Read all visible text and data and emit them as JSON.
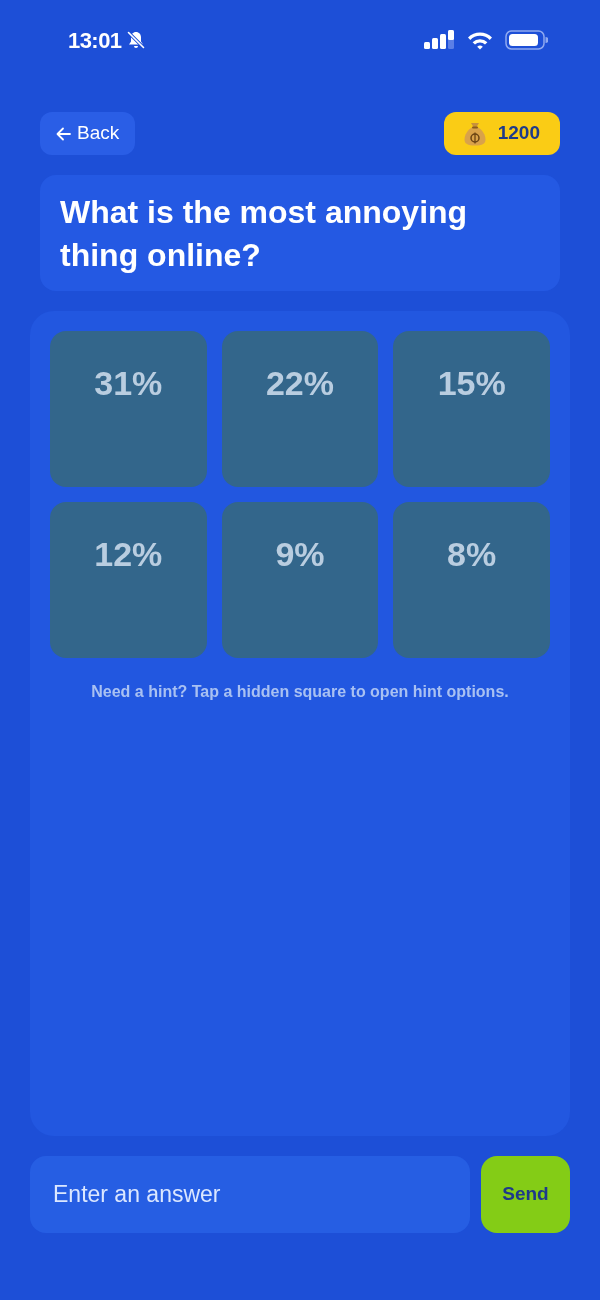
{
  "status_bar": {
    "time": "13:01"
  },
  "header": {
    "back_button": {
      "label": "Back"
    },
    "coins": {
      "amount": "1200"
    }
  },
  "question": "What is the most annoying thing online?",
  "tiles": [
    {
      "percent": "31%"
    },
    {
      "percent": "22%"
    },
    {
      "percent": "15%"
    },
    {
      "percent": "12%"
    },
    {
      "percent": "9%"
    },
    {
      "percent": "8%"
    }
  ],
  "hint": "Need a hint? Tap a hidden square to open hint options.",
  "answer_field": {
    "placeholder": "Enter an answer"
  },
  "send_button": {
    "label": "Send"
  }
}
